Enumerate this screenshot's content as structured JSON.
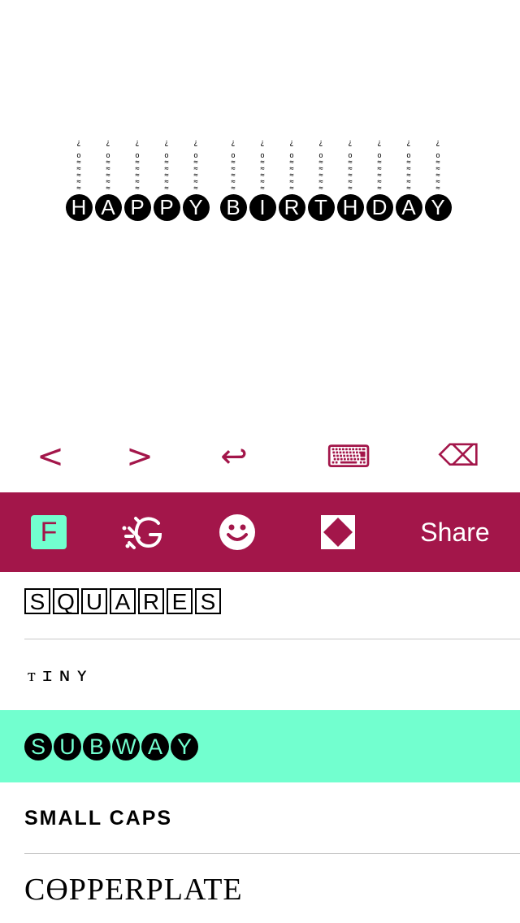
{
  "preview": {
    "candle": "¿\n¨\no\n≈\n≈\n≈\n≈\n≈",
    "letters": [
      "H",
      "A",
      "P",
      "P",
      "Y",
      " ",
      "B",
      "I",
      "R",
      "T",
      "H",
      "D",
      "A",
      "Y"
    ]
  },
  "edit_toolbar": {
    "prev_icon": "<",
    "next_icon": ">",
    "return_icon": "↩",
    "keyboard_icon": "⌨",
    "delete_icon": "⌫"
  },
  "tab_bar": {
    "fonts_tab_label": "F",
    "share_label": "Share",
    "colors": {
      "background": "#a3164a",
      "accent": "#72ffcf"
    }
  },
  "font_list": {
    "squares": [
      "S",
      "Q",
      "U",
      "A",
      "R",
      "E",
      "S"
    ],
    "tiny": "ᴛɪɴʏ",
    "subway": [
      "S",
      "U",
      "B",
      "W",
      "A",
      "Y"
    ],
    "small_caps": "SMALL CAPS",
    "copperplate": "CӨPPERPLATE",
    "selected": "subway"
  }
}
